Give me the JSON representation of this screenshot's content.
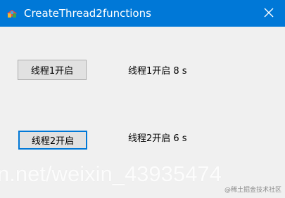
{
  "window": {
    "title": "CreateThread2functions",
    "titlebar_color": "#0078d7",
    "app_icon": "app-icon",
    "close_icon": "close-icon"
  },
  "controls": {
    "button1_label": "线程1开启",
    "button2_label": "线程2开启",
    "status1_text": "线程1开启 8 s",
    "status2_text": "线程2开启 6 s"
  },
  "overlay": {
    "watermark_text": "n.net/weixin_43935474",
    "badge_text": "@稀土掘金技术社区"
  }
}
